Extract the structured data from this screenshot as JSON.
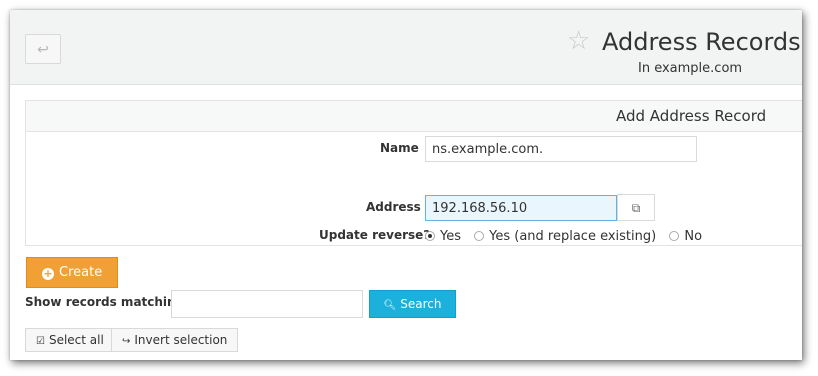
{
  "header": {
    "back_icon": "↩",
    "star_icon": "☆",
    "title": "Address Records",
    "subtitle": "In example.com"
  },
  "form": {
    "section_title": "Add Address Record",
    "name_label": "Name",
    "name_value": "ns.example.com.",
    "address_label": "Address",
    "address_value": "192.168.56.10",
    "address_addon_icon": "⧉",
    "update_reverse_label": "Update reverse?",
    "update_reverse_options": [
      "Yes",
      "Yes (and replace existing)",
      "No"
    ],
    "update_reverse_selected": "Yes"
  },
  "actions": {
    "create_label": "Create",
    "show_matching_label": "Show records matching:",
    "search_value": "",
    "search_label": "Search",
    "select_all_label": "Select all",
    "invert_selection_label": "Invert selection"
  },
  "colors": {
    "create_button": "#f0a035",
    "search_button": "#1bb1dc",
    "active_input": "#eaf6fd"
  }
}
